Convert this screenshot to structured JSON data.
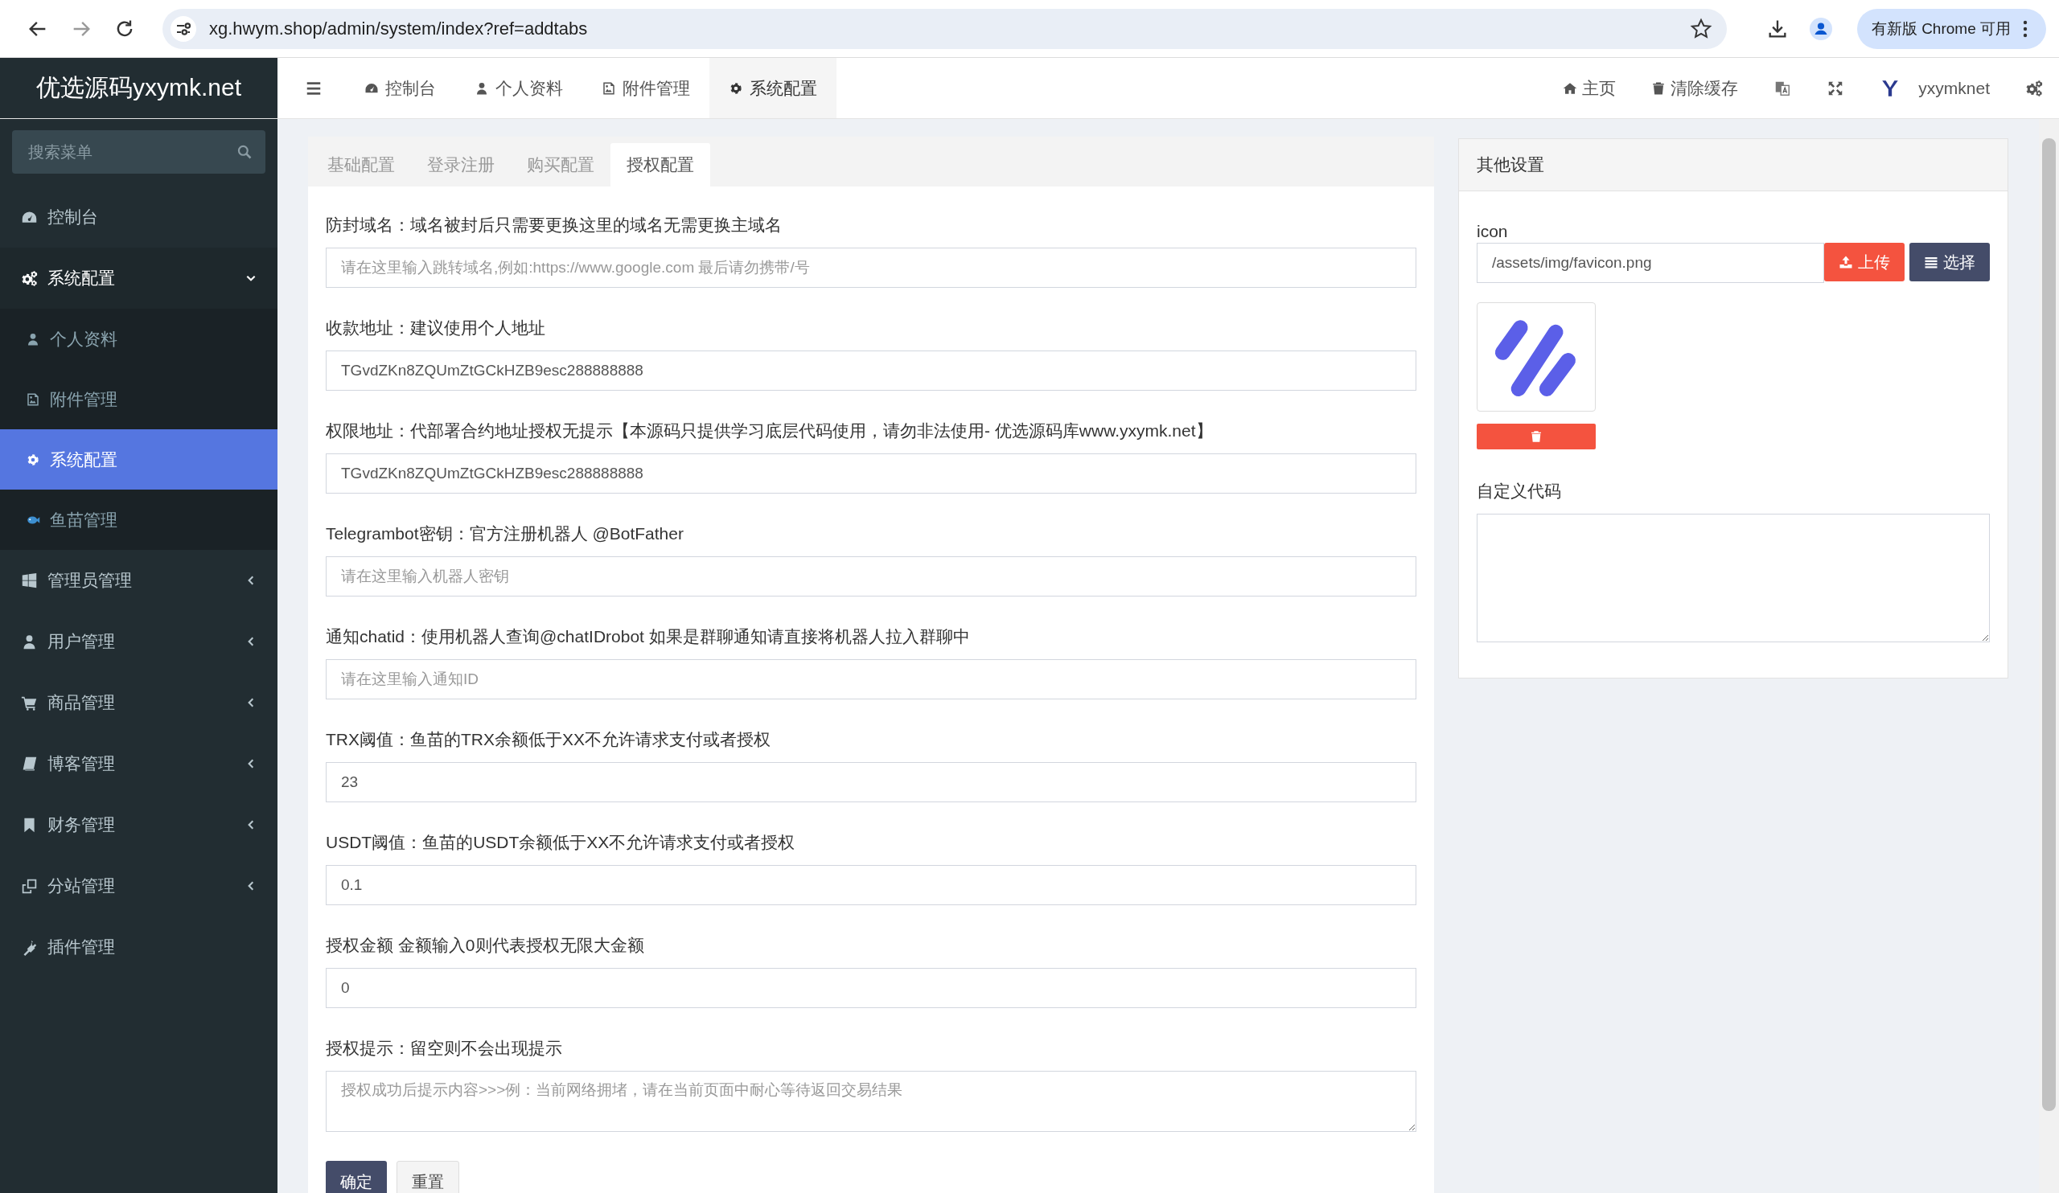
{
  "browser": {
    "url": "xg.hwym.shop/admin/system/index?ref=addtabs",
    "update_button": "有新版 Chrome 可用"
  },
  "header": {
    "logo": "优选源码yxymk.net",
    "tabs": [
      {
        "label": "控制台",
        "selected": false
      },
      {
        "label": "个人资料",
        "selected": false
      },
      {
        "label": "附件管理",
        "selected": false
      },
      {
        "label": "系统配置",
        "selected": true
      }
    ],
    "links": [
      {
        "label": "主页"
      },
      {
        "label": "清除缓存"
      }
    ],
    "user": "yxymknet"
  },
  "sidebar": {
    "search_placeholder": "搜索菜单",
    "items": [
      {
        "label": "控制台"
      },
      {
        "label": "系统配置",
        "expanded": true,
        "children": [
          {
            "label": "个人资料",
            "selected": false
          },
          {
            "label": "附件管理",
            "selected": false
          },
          {
            "label": "系统配置",
            "selected": true
          },
          {
            "label": "鱼苗管理",
            "selected": false
          }
        ]
      },
      {
        "label": "管理员管理",
        "expanded": false
      },
      {
        "label": "用户管理",
        "expanded": false
      },
      {
        "label": "商品管理",
        "expanded": false
      },
      {
        "label": "博客管理",
        "expanded": false
      },
      {
        "label": "财务管理",
        "expanded": false
      },
      {
        "label": "分站管理",
        "expanded": false
      },
      {
        "label": "插件管理"
      }
    ]
  },
  "form": {
    "tabs": [
      {
        "label": "基础配置",
        "selected": false
      },
      {
        "label": "登录注册",
        "selected": false
      },
      {
        "label": "购买配置",
        "selected": false
      },
      {
        "label": "授权配置",
        "selected": true
      }
    ],
    "fields": [
      {
        "kind": "input",
        "label": "防封域名：域名被封后只需要更换这里的域名无需更换主域名",
        "placeholder": "请在这里输入跳转域名,例如:https://www.google.com 最后请勿携带/号"
      },
      {
        "kind": "input",
        "label": "收款地址：建议使用个人地址",
        "value": "TGvdZKn8ZQUmZtGCkHZB9esc288888888"
      },
      {
        "kind": "input",
        "label": "权限地址：代部署合约地址授权无提示【本源码只提供学习底层代码使用，请勿非法使用- 优选源码库www.yxymk.net】",
        "value": "TGvdZKn8ZQUmZtGCkHZB9esc288888888"
      },
      {
        "kind": "input",
        "label": "Telegrambot密钥：官方注册机器人 @BotFather",
        "placeholder": "请在这里输入机器人密钥"
      },
      {
        "kind": "input",
        "label": "通知chatid：使用机器人查询@chatIDrobot 如果是群聊通知请直接将机器人拉入群聊中",
        "placeholder": "请在这里输入通知ID"
      },
      {
        "kind": "input",
        "label": "TRX阈值：鱼苗的TRX余额低于XX不允许请求支付或者授权",
        "value": "23"
      },
      {
        "kind": "input",
        "label": "USDT阈值：鱼苗的USDT余额低于XX不允许请求支付或者授权",
        "value": "0.1"
      },
      {
        "kind": "input",
        "label": "授权金额 金额输入0则代表授权无限大金额",
        "value": "0"
      },
      {
        "kind": "textarea",
        "label": "授权提示：留空则不会出现提示",
        "placeholder": "授权成功后提示内容>>>例：当前网络拥堵，请在当前页面中耐心等待返回交易结果"
      }
    ],
    "buttons": [
      {
        "label": "确定",
        "kind": "primary"
      },
      {
        "label": "重置",
        "kind": "default"
      }
    ]
  },
  "side_panel": {
    "title": "其他设置",
    "icon_label": "icon",
    "icon_value": "/assets/img/favicon.png",
    "upload_button": "上传",
    "choose_button": "选择",
    "custom_code_label": "自定义代码"
  }
}
